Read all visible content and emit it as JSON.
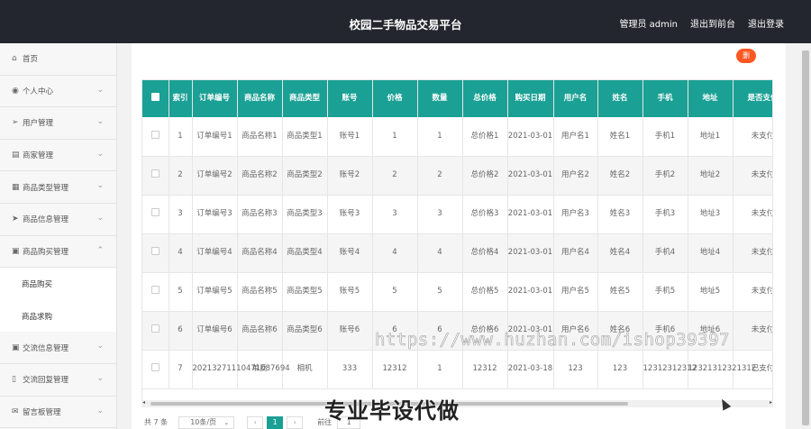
{
  "header": {
    "title": "校园二手物品交易平台",
    "admin_label": "管理员 admin",
    "to_front_label": "退出到前台",
    "logout_label": "退出登录"
  },
  "sidebar": {
    "items": [
      {
        "label": "首页",
        "icon": "home-icon"
      },
      {
        "label": "个人中心",
        "icon": "user-icon"
      },
      {
        "label": "用户管理",
        "icon": "send-icon"
      },
      {
        "label": "商家管理",
        "icon": "store-icon"
      },
      {
        "label": "商品类型管理",
        "icon": "grid-icon"
      },
      {
        "label": "商品信息管理",
        "icon": "plane-icon"
      },
      {
        "label": "商品购买管理",
        "icon": "bag-icon"
      },
      {
        "label": "商品购买",
        "icon": ""
      },
      {
        "label": "商品求购",
        "icon": ""
      },
      {
        "label": "交流信息管理",
        "icon": "bag-icon"
      },
      {
        "label": "交流回复管理",
        "icon": "phone-icon"
      },
      {
        "label": "留言板管理",
        "icon": "mail-icon"
      }
    ]
  },
  "toolbar": {
    "delete_label": "删"
  },
  "table": {
    "headers": [
      "索引",
      "订单编号",
      "商品名称",
      "商品类型",
      "账号",
      "价格",
      "数量",
      "总价格",
      "购买日期",
      "用户名",
      "姓名",
      "手机",
      "地址",
      "是否支付"
    ],
    "rows": [
      [
        "1",
        "订单编号1",
        "商品名称1",
        "商品类型1",
        "账号1",
        "1",
        "1",
        "总价格1",
        "2021-03-01",
        "用户名1",
        "姓名1",
        "手机1",
        "地址1",
        "未支付"
      ],
      [
        "2",
        "订单编号2",
        "商品名称2",
        "商品类型2",
        "账号2",
        "2",
        "2",
        "总价格2",
        "2021-03-01",
        "用户名2",
        "姓名2",
        "手机2",
        "地址2",
        "未支付"
      ],
      [
        "3",
        "订单编号3",
        "商品名称3",
        "商品类型3",
        "账号3",
        "3",
        "3",
        "总价格3",
        "2021-03-01",
        "用户名3",
        "姓名3",
        "手机3",
        "地址3",
        "未支付"
      ],
      [
        "4",
        "订单编号4",
        "商品名称4",
        "商品类型4",
        "账号4",
        "4",
        "4",
        "总价格4",
        "2021-03-01",
        "用户名4",
        "姓名4",
        "手机4",
        "地址4",
        "未支付"
      ],
      [
        "5",
        "订单编号5",
        "商品名称5",
        "商品类型5",
        "账号5",
        "5",
        "5",
        "总价格5",
        "2021-03-01",
        "用户名5",
        "姓名5",
        "手机5",
        "地址5",
        "未支付"
      ],
      [
        "6",
        "订单编号6",
        "商品名称6",
        "商品类型6",
        "账号6",
        "6",
        "6",
        "总价格6",
        "2021-03-01",
        "用户名6",
        "姓名6",
        "手机6",
        "地址6",
        "未支付"
      ],
      [
        "7",
        "20213271110471087694",
        "单反",
        "相机",
        "333",
        "12312",
        "1",
        "12312",
        "2021-03-18",
        "123",
        "123",
        "12312312312",
        "12321312321312",
        "已支付"
      ]
    ]
  },
  "pager": {
    "total": "共 7 条",
    "page_size": "10条/页",
    "prev": "‹",
    "current": "1",
    "next": "›",
    "goto_label": "前往",
    "goto_value": "1"
  },
  "overlay": {
    "watermark": "https://www.huzhan.com/ishop39397",
    "caption": "专业毕设代做"
  },
  "colors": {
    "accent": "#1aa094",
    "topbar": "#23262e",
    "danger": "#ff5722"
  }
}
